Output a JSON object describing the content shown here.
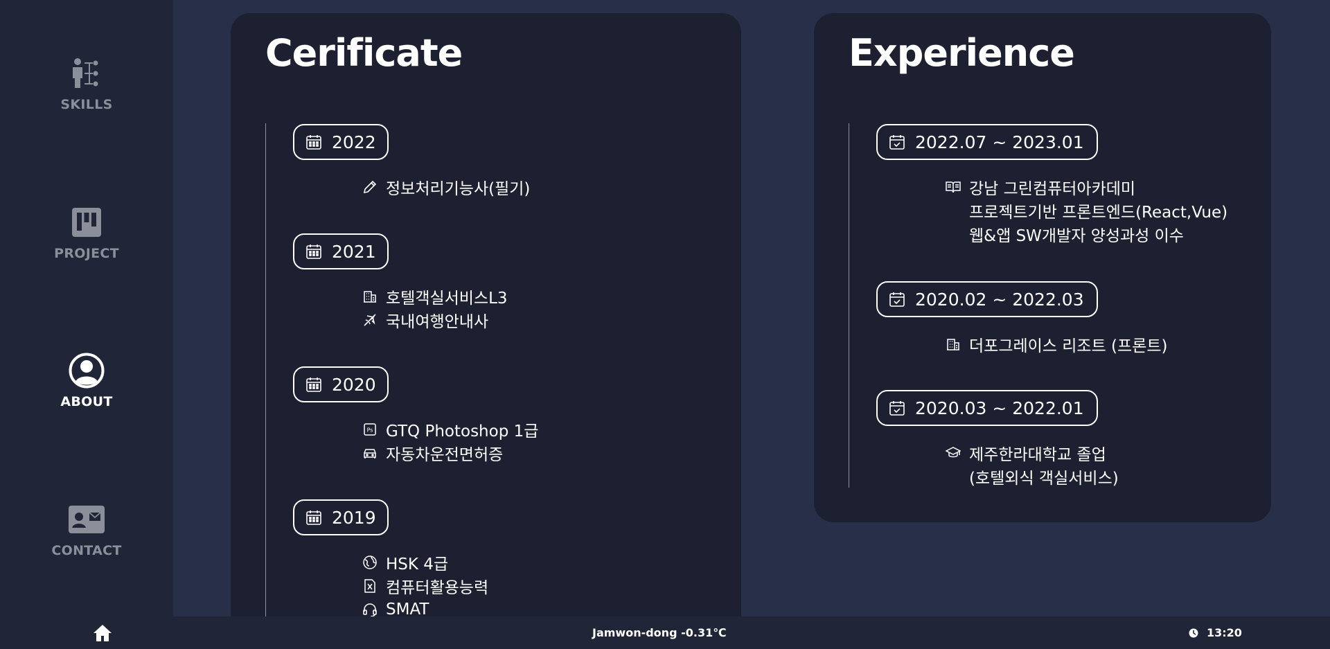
{
  "sidebar": {
    "items": [
      {
        "label": "SKILLS",
        "icon": "org-chart-person-icon",
        "active": false
      },
      {
        "label": "PROJECT",
        "icon": "kanban-board-icon",
        "active": false
      },
      {
        "label": "ABOUT",
        "icon": "user-circle-icon",
        "active": true
      },
      {
        "label": "CONTACT",
        "icon": "contact-card-icon",
        "active": false
      }
    ]
  },
  "certificate": {
    "title": "Cerificate",
    "groups": [
      {
        "year": "2022",
        "items": [
          {
            "icon": "pencil-icon",
            "text": "정보처리기능사(필기)"
          }
        ]
      },
      {
        "year": "2021",
        "items": [
          {
            "icon": "building-icon",
            "text": "호텔객실서비스L3"
          },
          {
            "icon": "airplane-icon",
            "text": "국내여행안내사"
          }
        ]
      },
      {
        "year": "2020",
        "items": [
          {
            "icon": "photoshop-icon",
            "text": "GTQ Photoshop 1급"
          },
          {
            "icon": "car-icon",
            "text": "자동차운전면허증"
          }
        ]
      },
      {
        "year": "2019",
        "items": [
          {
            "icon": "globe-icon",
            "text": "HSK 4급"
          },
          {
            "icon": "excel-file-icon",
            "text": "컴퓨터활용능력"
          },
          {
            "icon": "headset-icon",
            "text": "SMAT"
          }
        ]
      }
    ]
  },
  "experience": {
    "title": "Experience",
    "groups": [
      {
        "period": "2022.07 ~ 2023.01",
        "lines": [
          "강남 그린컴퓨터아카데미",
          "프로젝트기반 프론트엔드(React,Vue)",
          "웹&앱 SW개발자 양성과성 이수"
        ],
        "icon": "book-icon"
      },
      {
        "period": "2020.02 ~ 2022.03",
        "lines": [
          "더포그레이스 리조트 (프론트)"
        ],
        "icon": "building-icon"
      },
      {
        "period": "2020.03 ~ 2022.01",
        "lines": [
          "제주한라대학교 졸업",
          "(호텔외식 객실서비스)"
        ],
        "icon": "graduation-cap-icon"
      }
    ]
  },
  "footer": {
    "weather": "Jamwon-dong -0.31℃",
    "time": "13:20"
  },
  "colors": {
    "background": "#282f48",
    "sidebar": "#202537",
    "card": "#1c2030",
    "inactive_label": "#8b8f99"
  }
}
